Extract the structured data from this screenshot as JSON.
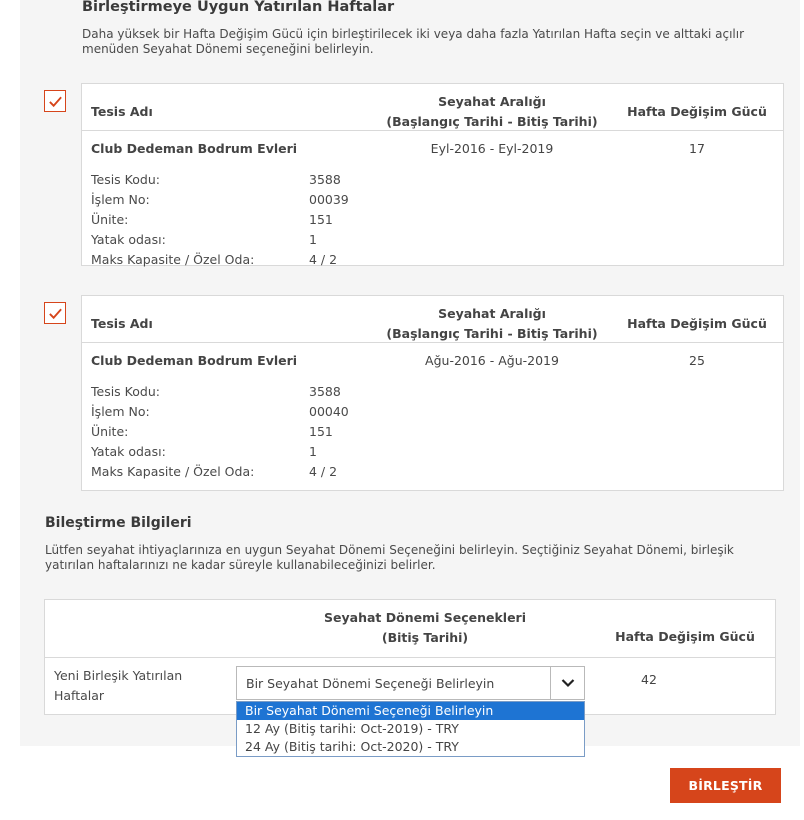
{
  "page": {
    "heading": "Birleştirmeye Uygun Yatırılan Haftalar",
    "intro": "Daha yüksek bir Hafta Değişim Gücü için birleştirilecek iki veya daha fazla Yatırılan Hafta seçin ve alttaki açılır menüden Seyahat Dönemi seçeneğini belirleyin."
  },
  "table_headers": {
    "facility": "Tesis Adı",
    "range_line1": "Seyahat Aralığı",
    "range_line2": "(Başlangıç Tarihi - Bitiş Tarihi)",
    "power": "Hafta Değişim Gücü"
  },
  "detail_labels": {
    "code": "Tesis Kodu:",
    "transaction": "İşlem No:",
    "unit": "Ünite:",
    "bedrooms": "Yatak odası:",
    "capacity": "Maks Kapasite / Özel Oda:"
  },
  "weeks": [
    {
      "checked": true,
      "facility_name": "Club Dedeman Bodrum Evleri",
      "code": "3588",
      "transaction": "00039",
      "unit": "151",
      "bedrooms": "1",
      "capacity": "4 / 2",
      "range": "Eyl-2016 - Eyl-2019",
      "power": "17"
    },
    {
      "checked": true,
      "facility_name": "Club Dedeman Bodrum Evleri",
      "code": "3588",
      "transaction": "00040",
      "unit": "151",
      "bedrooms": "1",
      "capacity": "4 / 2",
      "range": "Ağu-2016 - Ağu-2019",
      "power": "25"
    }
  ],
  "combine": {
    "title": "Bileştirme Bilgileri",
    "description": "Lütfen seyahat ihtiyaçlarınıza en uygun Seyahat Dönemi Seçeneğini belirleyin. Seçtiğiniz Seyahat Dönemi, birleşik yatırılan haftalarınızı ne kadar süreyle kullanabileceğinizi belirler.",
    "header_period_line1": "Seyahat Dönemi Seçenekleri",
    "header_period_line2": "(Bitiş Tarihi)",
    "header_power": "Hafta Değişim Gücü",
    "row_label": "Yeni Birleşik Yatırılan Haftalar",
    "power": "42",
    "select_value": "Bir Seyahat Dönemi Seçeneği Belirleyin",
    "options": [
      "Bir Seyahat Dönemi Seçeneği Belirleyin",
      "12 Ay (Bitiş tarihi: Oct-2019) - TRY",
      "24 Ay (Bitiş tarihi: Oct-2020) - TRY"
    ],
    "selected_option_index": 0
  },
  "actions": {
    "combine_button": "BİRLEŞTİR"
  },
  "colors": {
    "accent": "#d6451b",
    "highlight": "#1e74d3",
    "panel": "#f5f5f5"
  },
  "icons": {
    "checkbox": "checkmark-icon",
    "select": "chevron-down-icon"
  }
}
